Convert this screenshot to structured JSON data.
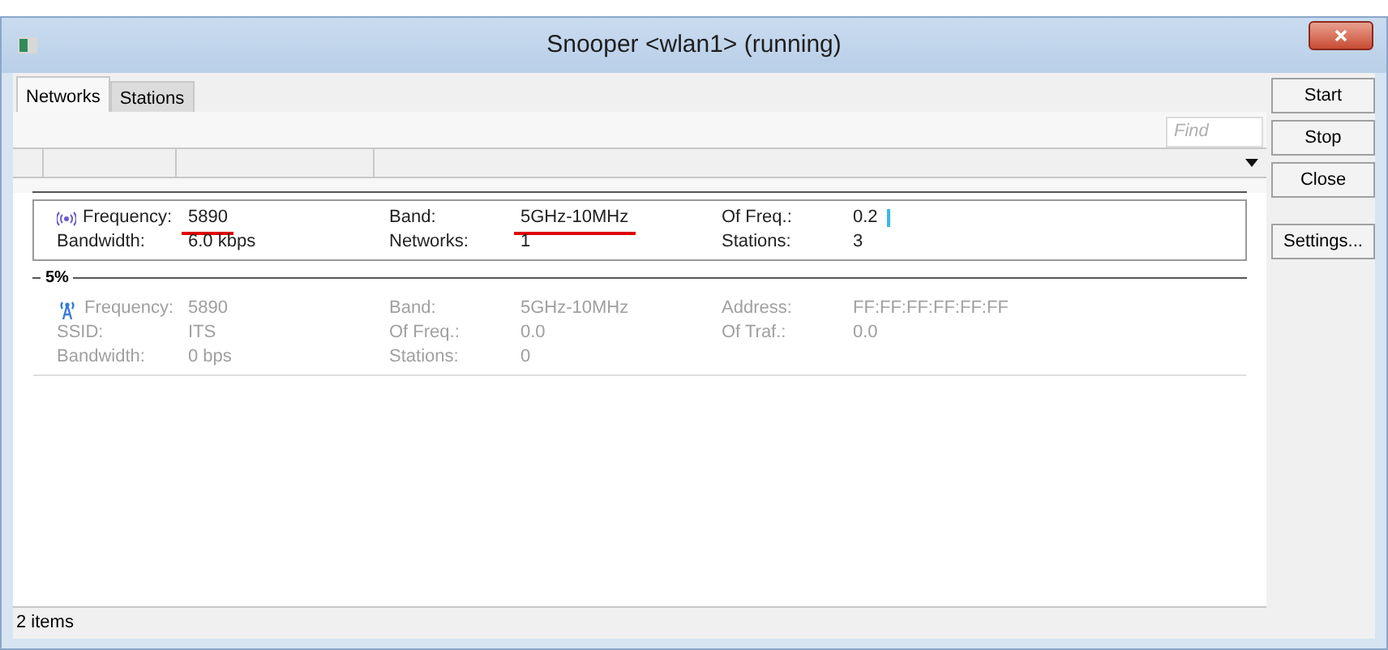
{
  "window": {
    "title": "Snooper <wlan1> (running)"
  },
  "tabs": [
    {
      "label": "Networks",
      "selected": true
    },
    {
      "label": "Stations",
      "selected": false
    }
  ],
  "find": {
    "placeholder": "Find"
  },
  "list": [
    {
      "kind": "record",
      "disabled": false,
      "rows": [
        [
          {
            "label": "Frequency:",
            "value": "5890",
            "underlined": true
          },
          {
            "label": "Band:",
            "value": "5GHz-10MHz",
            "underlined": true
          },
          {
            "label": "Of Freq.:",
            "value": "0.2",
            "cursor": true
          }
        ],
        [
          {
            "label": "Bandwidth:",
            "value": "6.0 kbps"
          },
          {
            "label": "Networks:",
            "value": "1"
          },
          {
            "label": "Stations:",
            "value": "3"
          }
        ]
      ]
    },
    {
      "kind": "group",
      "label": "5%"
    },
    {
      "kind": "record",
      "disabled": true,
      "rows": [
        [
          {
            "label": "Frequency:",
            "value": "5890"
          },
          {
            "label": "Band:",
            "value": "5GHz-10MHz"
          },
          {
            "label": "Address:",
            "value": "FF:FF:FF:FF:FF:FF"
          }
        ],
        [
          {
            "label": "SSID:",
            "value": "ITS"
          },
          {
            "label": "Of Freq.:",
            "value": "0.0"
          },
          {
            "label": "Of Traf.:",
            "value": "0.0"
          }
        ],
        [
          {
            "label": "Bandwidth:",
            "value": "0 bps"
          },
          {
            "label": "Stations:",
            "value": "0"
          }
        ]
      ]
    }
  ],
  "buttons": [
    "Start",
    "Stop",
    "Close",
    "Settings..."
  ],
  "status_bar": "2 items"
}
